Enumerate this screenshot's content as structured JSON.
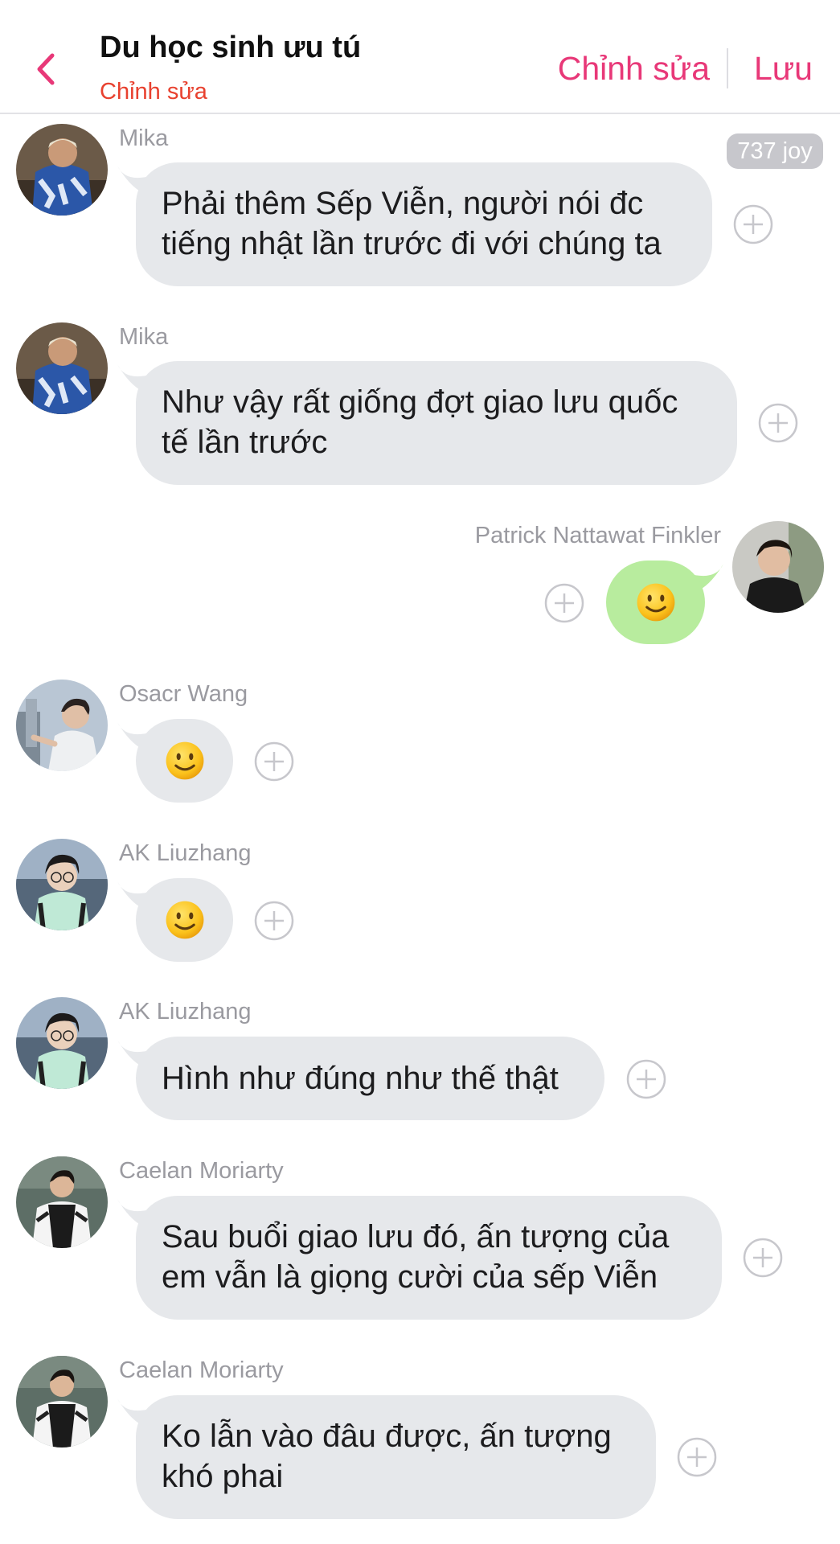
{
  "header": {
    "title": "Du học sinh ưu tú",
    "subtitle": "Chỉnh sửa",
    "edit_label": "Chỉnh sửa",
    "save_label": "Lưu",
    "accent_color": "#e83878",
    "subtitle_color": "#e8412f"
  },
  "badge": {
    "joy": "737 joy"
  },
  "messages": [
    {
      "sender": "Mika",
      "lines": [
        "Phải thêm Sếp Viễn, người nói đc",
        "tiếng nhật lần trước đi với chúng ta"
      ],
      "side": "left"
    },
    {
      "sender": "Mika",
      "lines": [
        "Như vậy rất giống đợt giao lưu quốc",
        "tế lần trước"
      ],
      "side": "left"
    },
    {
      "sender": "Patrick Nattawat Finkler",
      "emoji": "slightly-smiling-face",
      "side": "right"
    },
    {
      "sender": "Osacr Wang",
      "emoji": "slightly-smiling-face",
      "side": "left"
    },
    {
      "sender": "AK Liuzhang",
      "emoji": "slightly-smiling-face",
      "side": "left"
    },
    {
      "sender": "AK Liuzhang",
      "lines": [
        "Hình như đúng như thế thật"
      ],
      "side": "left"
    },
    {
      "sender": "Caelan Moriarty",
      "lines": [
        "Sau buổi giao lưu đó, ấn tượng của",
        "em vẫn là giọng cười của sếp Viễn"
      ],
      "side": "left"
    },
    {
      "sender": "Caelan Moriarty",
      "lines": [
        "Ko lẫn vào đâu được, ấn tượng",
        "khó phai"
      ],
      "side": "left"
    }
  ],
  "colors": {
    "bubble_gray": "#e6e8eb",
    "bubble_green": "#b8ec9e",
    "sender_gray": "#9a9aa0"
  }
}
